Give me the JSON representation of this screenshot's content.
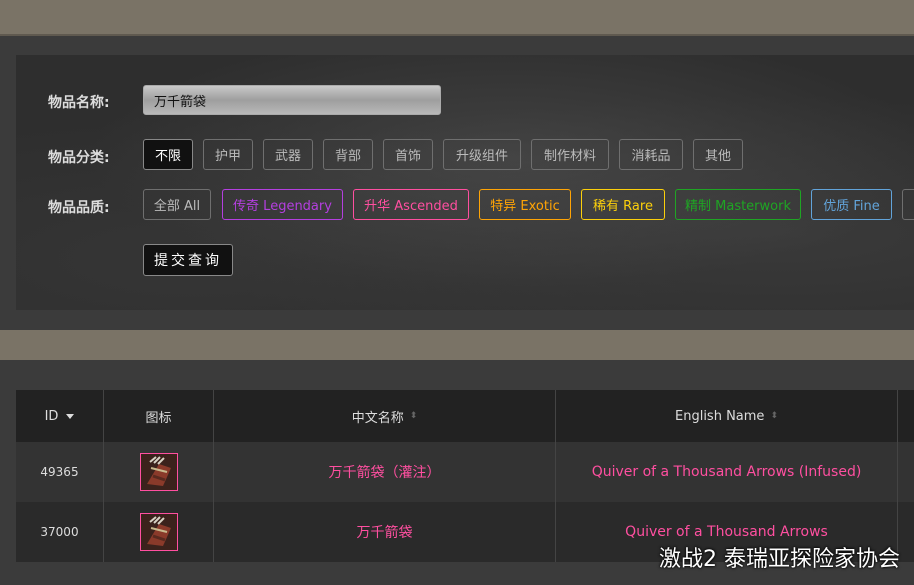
{
  "search": {
    "name_label": "物品名称:",
    "name_value": "万千箭袋",
    "category_label": "物品分类:",
    "categories": [
      "不限",
      "护甲",
      "武器",
      "背部",
      "首饰",
      "升级组件",
      "制作材料",
      "消耗品",
      "其他"
    ],
    "quality_label": "物品品质:",
    "qualities": [
      {
        "label": "全部 All",
        "color": "#bbbbbb"
      },
      {
        "label": "传奇 Legendary",
        "color": "#b43fe0"
      },
      {
        "label": "升华 Ascended",
        "color": "#ff4fa0"
      },
      {
        "label": "特异 Exotic",
        "color": "#ffa405"
      },
      {
        "label": "稀有 Rare",
        "color": "#fcd00b"
      },
      {
        "label": "精制 Masterwork",
        "color": "#1fa524"
      },
      {
        "label": "优质 Fine",
        "color": "#62a4da"
      }
    ],
    "submit_label": "提交查询"
  },
  "table": {
    "headers": {
      "id": "ID",
      "icon": "图标",
      "cn_name": "中文名称",
      "en_name": "English Name"
    },
    "rows": [
      {
        "id": "49365",
        "icon": "quiver-icon",
        "cn_name": "万千箭袋（灌注）",
        "en_name": "Quiver of a Thousand Arrows (Infused)"
      },
      {
        "id": "37000",
        "icon": "quiver-icon",
        "cn_name": "万千箭袋",
        "en_name": "Quiver of a Thousand Arrows"
      }
    ],
    "name_color": "#ff4fa0"
  },
  "watermark": "激战2 泰瑞亚探险家协会"
}
